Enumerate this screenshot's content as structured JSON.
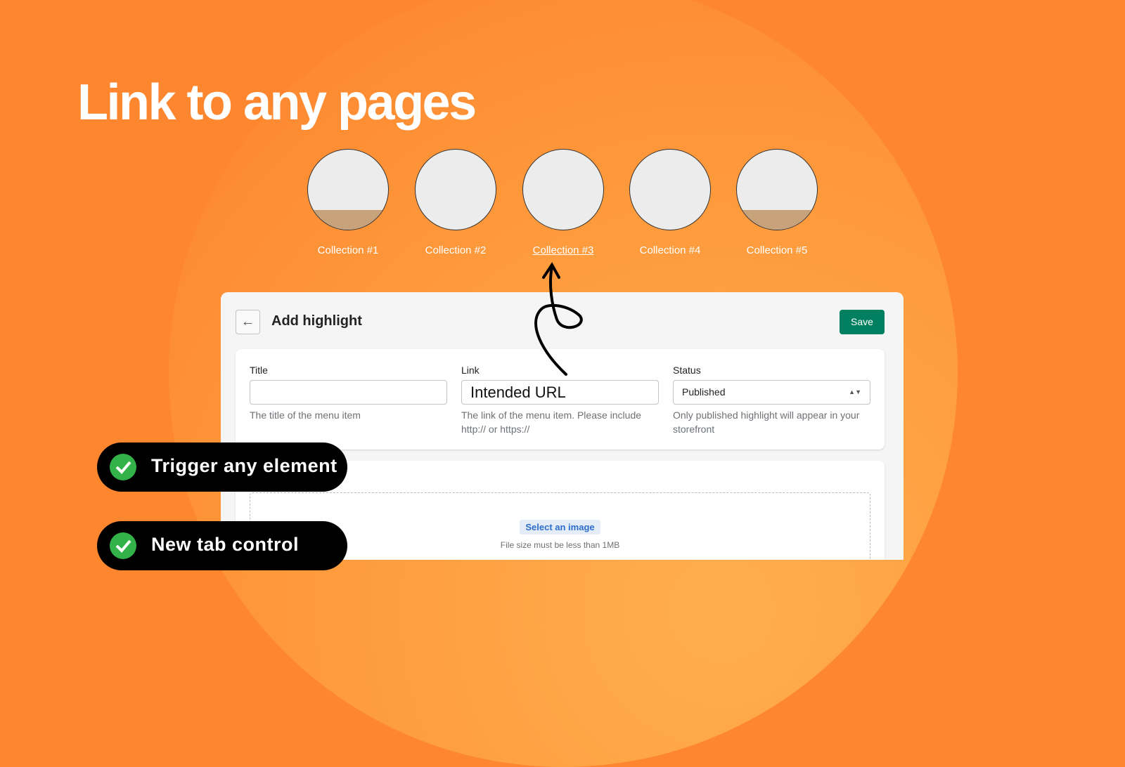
{
  "headline": "Link to any pages",
  "collections": [
    {
      "label": "Collection #1",
      "active": false
    },
    {
      "label": "Collection #2",
      "active": false
    },
    {
      "label": "Collection #3",
      "active": true
    },
    {
      "label": "Collection #4",
      "active": false
    },
    {
      "label": "Collection #5",
      "active": false
    }
  ],
  "form": {
    "title": "Add highlight",
    "save_label": "Save",
    "fields": {
      "title": {
        "label": "Title",
        "value": "",
        "help": "The title of the menu item"
      },
      "link": {
        "label": "Link",
        "value": "Intended URL",
        "help": "The link of the menu item. Please include http:// or https://"
      },
      "status": {
        "label": "Status",
        "value": "Published",
        "help": "Only published highlight will appear in your storefront"
      }
    },
    "image": {
      "button": "Select an image",
      "note": "File size must be less than 1MB"
    }
  },
  "features": [
    "Trigger any element",
    "New tab control"
  ],
  "colors": {
    "background": "#fe862f",
    "save": "#008060",
    "check": "#33b24a"
  }
}
